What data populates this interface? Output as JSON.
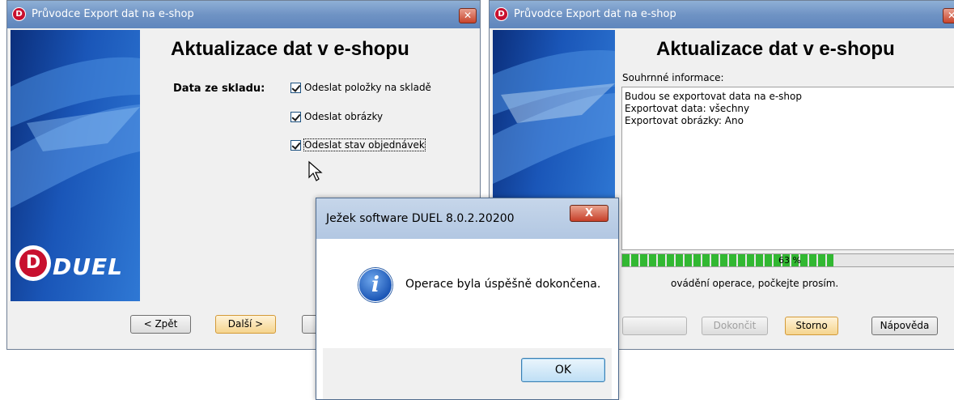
{
  "window1": {
    "title": "Průvodce Export dat na e-shop",
    "logo_letter": "D",
    "close_glyph": "✕",
    "heading": "Aktualizace dat v e-shopu",
    "section_label": "Data ze skladu:",
    "checkboxes": [
      {
        "label": "Odeslat položky na skladě",
        "checked": true
      },
      {
        "label": "Odeslat obrázky",
        "checked": true
      },
      {
        "label": "Odeslat stav objednávek",
        "checked": true
      }
    ],
    "buttons": {
      "back": "< Zpět",
      "next": "Další >"
    },
    "brand_letter": "D",
    "brand_text": "DUEL"
  },
  "window2": {
    "title": "Průvodce Export dat na e-shop",
    "logo_letter": "D",
    "close_glyph": "✕",
    "heading": "Aktualizace dat v e-shopu",
    "summary_label": "Souhrnné informace:",
    "summary_lines": [
      "Budou se exportovat data na e-shop",
      "Exportovat data: všechny",
      "Exportovat obrázky: Ano"
    ],
    "progress_percent": 63,
    "progress_label": "63 %",
    "status_text": "ovádění operace, počkejte prosím.",
    "buttons": {
      "finish": "Dokončit",
      "cancel": "Storno",
      "help": "Nápověda"
    }
  },
  "dialog": {
    "title": "Ježek software DUEL 8.0.2.20200",
    "close_glyph": "X",
    "message": "Operace byla úspěšně dokončena.",
    "info_glyph": "i",
    "ok_label": "OK"
  },
  "colors": {
    "titlebar": "#6f93c4",
    "sidebar": "#1a56b8",
    "progress": "#32b832",
    "close_red": "#c8442c"
  },
  "icons": [
    "duel-logo-icon",
    "close-icon",
    "info-icon",
    "mouse-cursor-icon"
  ]
}
